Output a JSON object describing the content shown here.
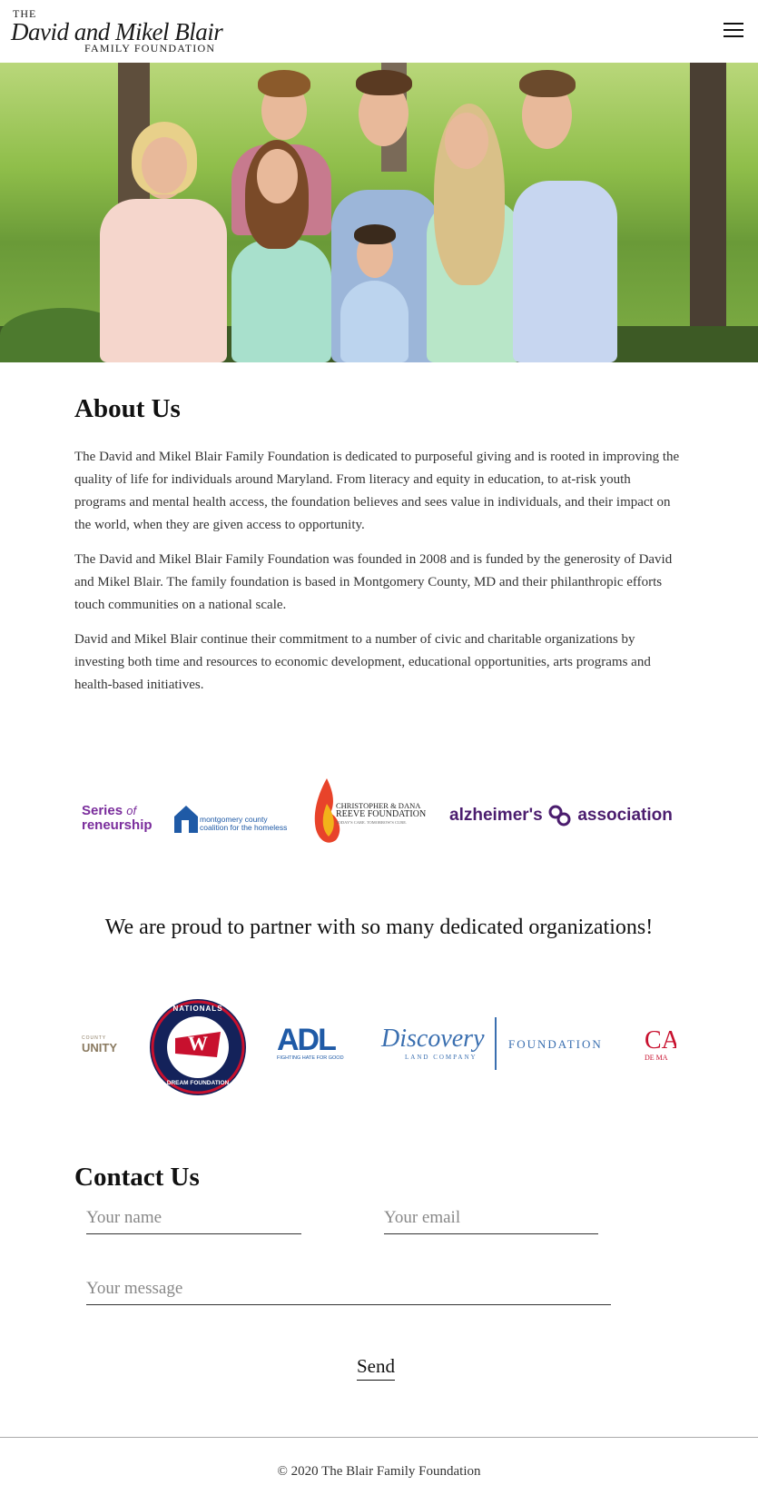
{
  "header": {
    "logo_the": "THE",
    "logo_names": "David and Mikel Blair",
    "logo_sub": "FAMILY FOUNDATION"
  },
  "about": {
    "title": "About Us",
    "paragraphs": [
      "The David and Mikel Blair Family Foundation is dedicated to purposeful giving and is rooted in improving the quality of life for individuals around Maryland. From literacy and equity in education, to at-risk youth programs and mental health access, the foundation believes and sees value in individuals, and their impact on the world, when they are given access to opportunity.",
      "The David and Mikel Blair Family Foundation was founded in 2008 and is funded by the generosity of David and Mikel Blair. The family foundation is based in Montgomery County, MD and their philanthropic efforts touch communities on a national scale.",
      "David and Mikel Blair continue their commitment to a number of civic and charitable organizations by investing both time and resources to economic development, educational opportunities, arts programs and health-based initiatives."
    ]
  },
  "partners_row1": {
    "series_line1": "Series",
    "series_of": "of",
    "series_line2": "reneurship",
    "montgomery_line1": "montgomery county",
    "montgomery_line2": "coalition for the homeless",
    "reeve_line1": "CHRISTOPHER & DANA",
    "reeve_line2": "REEVE FOUNDATION",
    "reeve_tag": "TODAY'S CARE. TOMORROW'S CURE.",
    "alz_left": "alzheimer's",
    "alz_right": "association"
  },
  "tagline": "We are proud to partner with so many dedicated organizations!",
  "partners_row2": {
    "community_small": "COUNTY",
    "community_big": "UNITY",
    "nationals_top": "NATIONALS",
    "nationals_bottom": "DREAM FOUNDATION",
    "adl": "ADL",
    "adl_tag": "FIGHTING HATE FOR GOOD",
    "discovery": "Discovery",
    "discovery_sub": "LAND COMPANY",
    "discovery_foundation": "FOUNDATION",
    "cut_big": "CA",
    "cut_small": "DE MA"
  },
  "contact": {
    "title": "Contact Us",
    "name_placeholder": "Your name",
    "email_placeholder": "Your email",
    "message_placeholder": "Your message",
    "send_label": "Send"
  },
  "footer": {
    "copyright": "© 2020 The Blair Family Foundation"
  },
  "colors": {
    "purple": "#6b2c91",
    "alz_purple": "#4b1d6e",
    "blue": "#1f5aa6",
    "red": "#c8102e",
    "navy": "#14225a"
  }
}
